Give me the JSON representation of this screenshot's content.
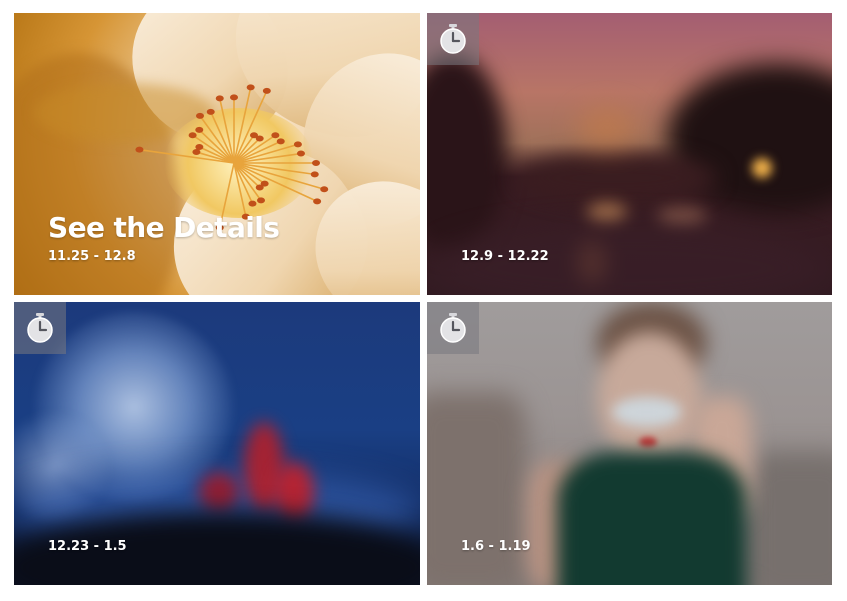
{
  "tiles": [
    {
      "title": "See the Details",
      "date": "11.25 - 12.8",
      "timer_icon": false
    },
    {
      "title": "",
      "date": "12.9 - 12.22",
      "timer_icon": true
    },
    {
      "title": "",
      "date": "12.23 - 1.5",
      "timer_icon": true
    },
    {
      "title": "",
      "date": "1.6 - 1.19",
      "timer_icon": true
    }
  ],
  "icons": {
    "timer": "stopwatch-icon"
  },
  "colors": {
    "caption_text": "#ffffff",
    "badge_bg": "#78787f"
  }
}
